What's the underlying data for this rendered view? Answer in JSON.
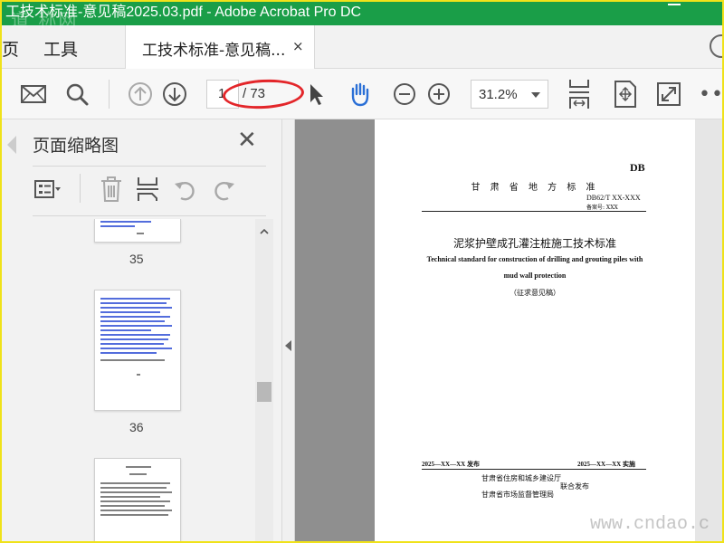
{
  "window": {
    "title": "工技术标准-意见稿2025.03.pdf - Adobe Acrobat Pro DC",
    "watermark_top": "道 称网"
  },
  "tabs": {
    "home": "页",
    "tools": "工具",
    "document": "工技术标准-意见稿...",
    "close": "×"
  },
  "toolbar": {
    "page_current": "1",
    "page_total": "/ 73",
    "zoom": "31.2%",
    "more": "•••"
  },
  "panel": {
    "title": "页面缩略图",
    "close": "✕",
    "thumbnails": [
      {
        "page": "35"
      },
      {
        "page": "36"
      },
      {
        "page": ""
      }
    ]
  },
  "document": {
    "db": "DB",
    "standard_type": "甘 肃 省 地 方 标 准",
    "code": "DB62/T XX-XXX",
    "record": "备案号: XXX",
    "title_zh": "泥浆护壁成孔灌注桩施工技术标准",
    "title_en_line1": "Technical standard for construction of drilling and grouting piles with",
    "title_en_line2": "mud wall protection",
    "draft_note": "（征求意见稿）",
    "issue_date": "2025—XX—XX 发布",
    "impl_date": "2025—XX—XX 实施",
    "dept1": "甘肃省住房和城乡建设厅",
    "joint": "联合发布",
    "dept2": "甘肃省市场监督管理局"
  },
  "watermark_bottom": "www.cndao.c",
  "colors": {
    "titlebar": "#1a9e48",
    "frame": "#f0e21a",
    "annotation": "#e3262a",
    "thumb_text": "#3553d6"
  }
}
